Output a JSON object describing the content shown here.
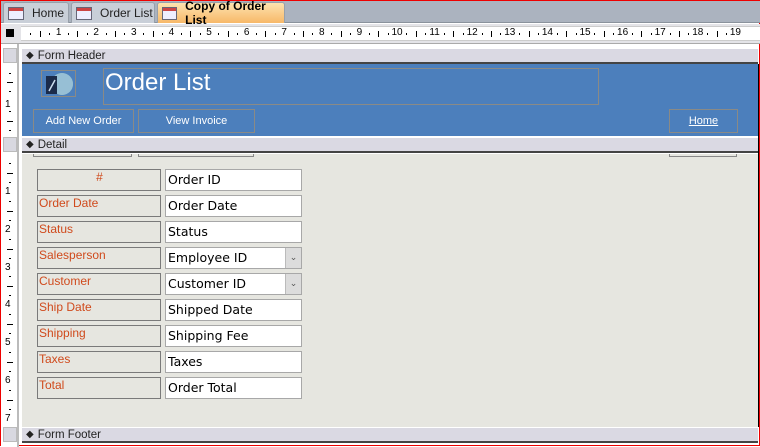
{
  "tabs": [
    {
      "label": "Home",
      "active": false
    },
    {
      "label": "Order List",
      "active": false
    },
    {
      "label": "Copy of Order List",
      "active": true
    }
  ],
  "ruler": {
    "h": [
      "1",
      "2",
      "3",
      "4",
      "5",
      "6",
      "7",
      "8",
      "9",
      "10",
      "11",
      "12",
      "13",
      "14",
      "15",
      "16",
      "17",
      "18",
      "19"
    ],
    "v_header": [
      "1"
    ],
    "v_detail": [
      "1",
      "2",
      "3",
      "4",
      "5",
      "6",
      "7"
    ]
  },
  "sections": {
    "header": "Form Header",
    "detail": "Detail",
    "footer": "Form Footer"
  },
  "form_header": {
    "title": "Order List",
    "logo_icon": "order-globe-icon",
    "add_new_order": "Add New Order",
    "view_invoice": "View Invoice",
    "home": "Home",
    "bg_color": "#4c7fbc"
  },
  "fields": [
    {
      "label": "#",
      "control": "Order ID",
      "combo": false
    },
    {
      "label": "Order Date",
      "control": "Order Date",
      "combo": false
    },
    {
      "label": "Status",
      "control": "Status",
      "combo": false
    },
    {
      "label": "Salesperson",
      "control": "Employee ID",
      "combo": true
    },
    {
      "label": "Customer",
      "control": "Customer ID",
      "combo": true
    },
    {
      "label": "Ship Date",
      "control": "Shipped Date",
      "combo": false
    },
    {
      "label": "Shipping",
      "control": "Shipping Fee",
      "combo": false
    },
    {
      "label": "Taxes",
      "control": "Taxes",
      "combo": false
    },
    {
      "label": "Total",
      "control": "Order Total",
      "combo": false
    }
  ],
  "colors": {
    "label_text": "#d04a1c",
    "active_tab": "#f7b868"
  }
}
